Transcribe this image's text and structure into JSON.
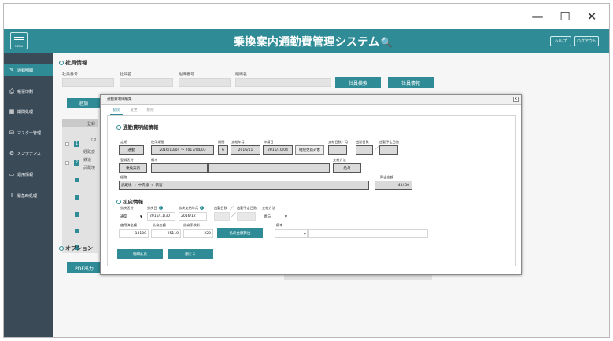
{
  "window": {
    "minimize": "—",
    "maximize": "☐",
    "close": "✕"
  },
  "header": {
    "menu_label": "MENU",
    "title": "乗換案内通勤費管理システム",
    "help": "ヘルプ",
    "logout": "ログアウト"
  },
  "sidebar": {
    "items": [
      {
        "label": "通勤明細",
        "icon": "pencil-icon"
      },
      {
        "label": "帳票印刷",
        "icon": "printer-icon"
      },
      {
        "label": "期間処理",
        "icon": "calendar-icon"
      },
      {
        "label": "マスター管理",
        "icon": "database-icon"
      },
      {
        "label": "メンテナンス",
        "icon": "gear-icon"
      },
      {
        "label": "運用情報",
        "icon": "monitor-icon"
      },
      {
        "label": "緊急時処理",
        "icon": "exclamation-icon"
      }
    ]
  },
  "employee": {
    "title": "社員情報",
    "labels": [
      "社員番号",
      "社員名",
      "組織番号",
      "組織名"
    ],
    "search_btn": "社員検索",
    "info_btn": "社員情報"
  },
  "bg": {
    "add_btn": "追加",
    "row_frag_1": "パス",
    "row_frag_2": "経路変",
    "row_frag_3": "鉄道",
    "row_frag_4": "武蔵境",
    "col_frag": "登録",
    "row_num_1": "1",
    "row_num_2": "2",
    "option_title": "オプション",
    "pdf_btn": "PDF出力"
  },
  "modal": {
    "title": "通勤費明細編集",
    "close": "x",
    "tabs": [
      "払戻",
      "変更",
      "削除"
    ],
    "detail_title": "通勤費明細情報",
    "l_kind": "定期",
    "l_period": "使用期間",
    "l_months": "期間",
    "l_pay_month": "支給年月",
    "l_apply_date": "申請日",
    "kind": "通勤",
    "period": "2016/10/04 〜 2017/04/03",
    "months": "6",
    "pay_month": "2016/11",
    "apply_date": "2016/10/04",
    "update_btn": "継続更新対象",
    "l_pay_days": "支給日数／月",
    "l_work_days": "出勤日数",
    "l_plan_days": "出勤予定日数",
    "l_reg_type": "登録区分",
    "reg_type": "乗換案内",
    "l_note": "備考",
    "l_pay_method": "支給方法",
    "pay_method": "給与",
    "l_route": "経路",
    "route": "武蔵境 -> 中央線 -> 新宿",
    "l_amount": "算出金額",
    "amount": "43430",
    "refund_title": "払戻情報",
    "l_refund_type": "払戻区分",
    "l_refund_date": "払戻日",
    "l_refund_pay_month": "払戻支給年月",
    "l_r_work_days": "出勤日数",
    "l_r_plan_days": "出勤予定日数",
    "l_r_pay_method": "支給方法",
    "refund_type": "通常",
    "refund_date": "2016/11/30",
    "refund_pay_month": "2016/12",
    "r_pay_method": "給与",
    "l_used": "使用済金額",
    "l_refund_amt": "払戻金額",
    "l_fee": "払戻手数料",
    "used": "18100",
    "refund_amt": "25110",
    "fee": "220",
    "calc_btn": "払戻金額算出",
    "l_memo": "備考",
    "detail_btn": "明細払戻",
    "close_btn": "閉じる"
  }
}
